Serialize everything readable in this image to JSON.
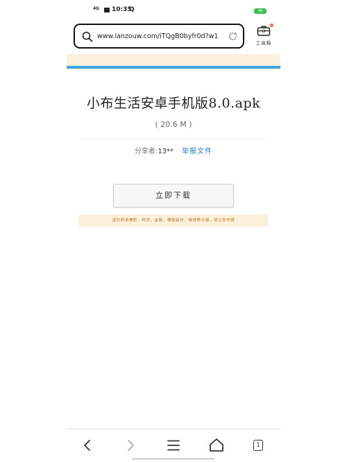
{
  "status_bar": {
    "signal": "4G",
    "time": "10:35",
    "battery": "99"
  },
  "address_bar": {
    "url": "www.lanzouw.com/iTQgB0byfr0d?w1"
  },
  "toolbox": {
    "label": "工具箱"
  },
  "file": {
    "title": "小布生活安卓手机版8.0.apk",
    "size": "( 20.6 M )",
    "sharer_label": "分享者:",
    "sharer_name": "13**",
    "report_label": "举报文件"
  },
  "download": {
    "button_label": "立即下载"
  },
  "warning": {
    "text": "谨防刷单兼职、网贷、金融、裸聊敲诈、赌博等诈骗，请立即举报"
  },
  "bottom_nav": {
    "tab_count": "1"
  },
  "colors": {
    "accent_blue": "#3ea3de",
    "banner_bg": "#faf0dc",
    "warning_text": "#c07b30",
    "battery_green": "#3fbf4f",
    "link_blue": "#2a7fd0"
  }
}
